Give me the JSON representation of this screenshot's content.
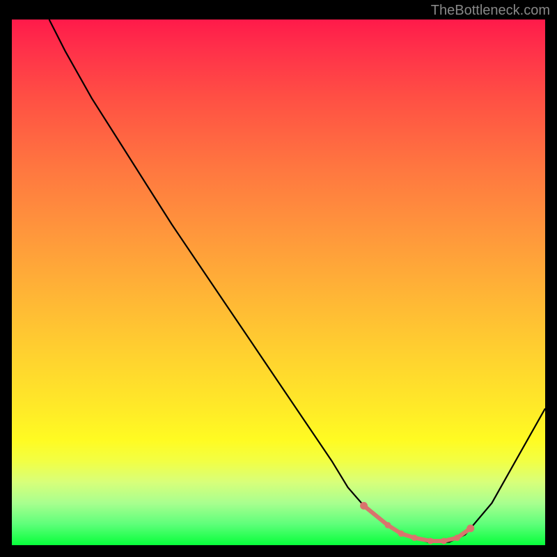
{
  "watermark": "TheBottleneck.com",
  "chart_data": {
    "type": "line",
    "title": "",
    "xlabel": "",
    "ylabel": "",
    "xlim": [
      0,
      100
    ],
    "ylim": [
      0,
      100
    ],
    "series": [
      {
        "name": "curve",
        "x": [
          7,
          10,
          15,
          20,
          25,
          30,
          35,
          40,
          45,
          50,
          55,
          60,
          63,
          66,
          70,
          74,
          78,
          82,
          85,
          90,
          95,
          100
        ],
        "values": [
          100,
          94,
          85,
          77,
          69,
          61,
          53.5,
          46,
          38.5,
          31,
          23.5,
          16,
          11,
          7.5,
          4,
          1.8,
          0.6,
          0.6,
          2,
          8,
          17,
          26
        ]
      }
    ],
    "highlight_region": {
      "points": [
        {
          "x": 66,
          "y": 7.5
        },
        {
          "x": 70.5,
          "y": 3.8
        },
        {
          "x": 73,
          "y": 2.2
        },
        {
          "x": 75.5,
          "y": 1.4
        },
        {
          "x": 78.5,
          "y": 0.8
        },
        {
          "x": 81,
          "y": 0.8
        },
        {
          "x": 83.5,
          "y": 1.4
        },
        {
          "x": 86,
          "y": 3.2
        }
      ]
    }
  },
  "colors": {
    "black": "#000000",
    "highlight": "#d9746d",
    "gradient_top": "#ff1a4a",
    "gradient_bottom": "#07ff3a"
  }
}
